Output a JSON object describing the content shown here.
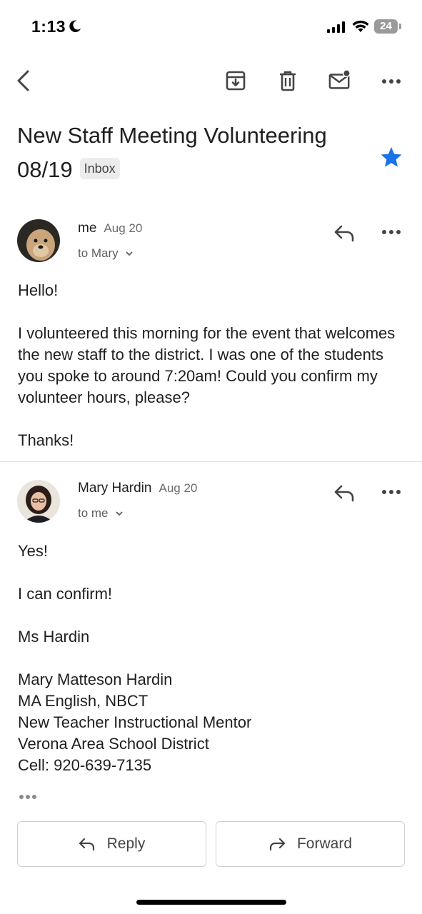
{
  "status": {
    "time": "1:13",
    "battery": "24"
  },
  "toolbar": {
    "back": "back-arrow-icon",
    "archive": "archive-icon",
    "delete": "trash-icon",
    "unread": "mark-unread-icon",
    "more": "more-horizontal-icon"
  },
  "subject": {
    "line1": "New Staff Meeting Volunteering",
    "line2": "08/19",
    "label": "Inbox"
  },
  "colors": {
    "star": "#1a73e8",
    "text": "#1f1f1f",
    "muted": "#5f5f5f"
  },
  "messages": [
    {
      "sender": "me",
      "date": "Aug 20",
      "to": "to Mary",
      "body": [
        "Hello!",
        "I volunteered this morning for the event that welcomes the new staff to the district. I was one of the students you spoke to around 7:20am! Could you confirm my volunteer hours, please?",
        "Thanks!"
      ]
    },
    {
      "sender": "Mary Hardin",
      "date": "Aug 20",
      "to": "to me",
      "body": [
        "Yes!",
        "I can confirm!",
        "Ms Hardin"
      ],
      "signature": [
        "Mary Matteson Hardin",
        "MA English, NBCT",
        "New Teacher Instructional Mentor",
        "Verona Area School District",
        "Cell: 920-639-7135"
      ]
    }
  ],
  "actions": {
    "reply": "Reply",
    "forward": "Forward"
  }
}
